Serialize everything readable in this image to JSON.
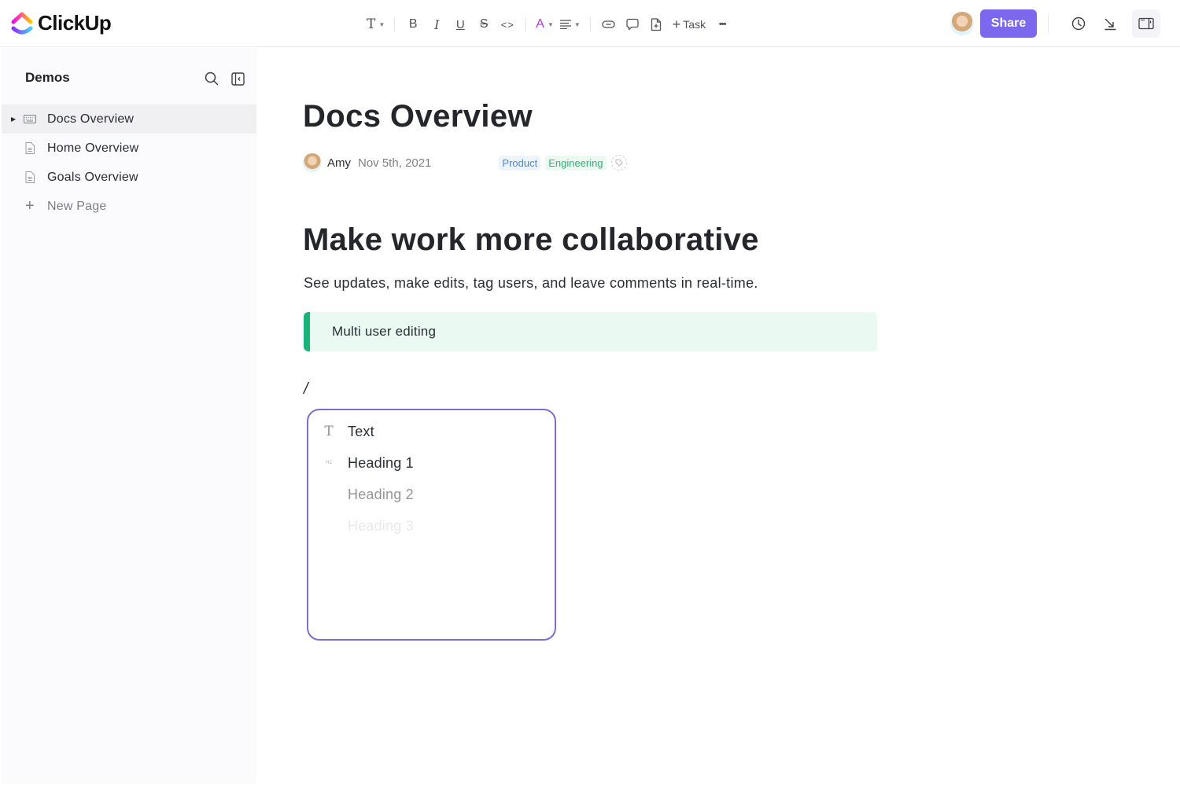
{
  "app": {
    "brand": "ClickUp",
    "colors": {
      "accent": "#7b68ee",
      "callout_border": "#1cb37a",
      "callout_bg": "#eafaf2",
      "tag_product": "#4a89dc",
      "tag_engineering": "#2cb673",
      "menu_border": "#7b6fd6"
    }
  },
  "toolbar": {
    "items": [
      {
        "name": "text-style",
        "icon": "text-T-icon",
        "has_caret": true
      },
      {
        "name": "bold",
        "icon": "bold-icon",
        "label": "B"
      },
      {
        "name": "italic",
        "icon": "italic-icon",
        "label": "I"
      },
      {
        "name": "underline",
        "icon": "underline-icon",
        "label": "U"
      },
      {
        "name": "strikethrough",
        "icon": "strikethrough-icon",
        "label": "S"
      },
      {
        "name": "code",
        "icon": "code-icon",
        "label": "<>"
      },
      {
        "name": "text-color",
        "icon": "text-color-icon",
        "label": "A",
        "has_caret": true
      },
      {
        "name": "align",
        "icon": "align-icon",
        "has_caret": true
      },
      {
        "name": "link",
        "icon": "link-icon"
      },
      {
        "name": "comment",
        "icon": "comment-icon"
      },
      {
        "name": "add-page",
        "icon": "page-add-icon"
      }
    ],
    "task_label": "Task",
    "more_label": "•••"
  },
  "header_right": {
    "share_label": "Share",
    "icons": [
      "history-clock-icon",
      "collapse-arrow-icon",
      "sidebar-panel-icon"
    ]
  },
  "sidebar": {
    "title": "Demos",
    "items": [
      {
        "label": "Docs Overview",
        "icon": "doc-keyboard-icon",
        "active": true,
        "expandable": true
      },
      {
        "label": "Home Overview",
        "icon": "page-icon",
        "active": false
      },
      {
        "label": "Goals Overview",
        "icon": "page-icon",
        "active": false
      }
    ],
    "new_page_label": "New Page"
  },
  "doc": {
    "title": "Docs Overview",
    "author": "Amy",
    "date": "Nov 5th, 2021",
    "tags": [
      "Product",
      "Engineering"
    ],
    "heading": "Make work more collaborative",
    "paragraph": "See updates, make edits, tag users, and leave comments in real-time.",
    "callout": "Multi user editing",
    "slash_input": "/"
  },
  "slash_menu": {
    "items": [
      {
        "label": "Text",
        "icon": "text-T-icon",
        "opacity": 1.0
      },
      {
        "label": "Heading 1",
        "icon": "heading-1-icon",
        "opacity": 1.0
      },
      {
        "label": "Heading 2",
        "icon": "heading-2-icon",
        "opacity": 0.45
      },
      {
        "label": "Heading 3",
        "icon": "heading-3-icon",
        "opacity": 0.12
      }
    ]
  }
}
